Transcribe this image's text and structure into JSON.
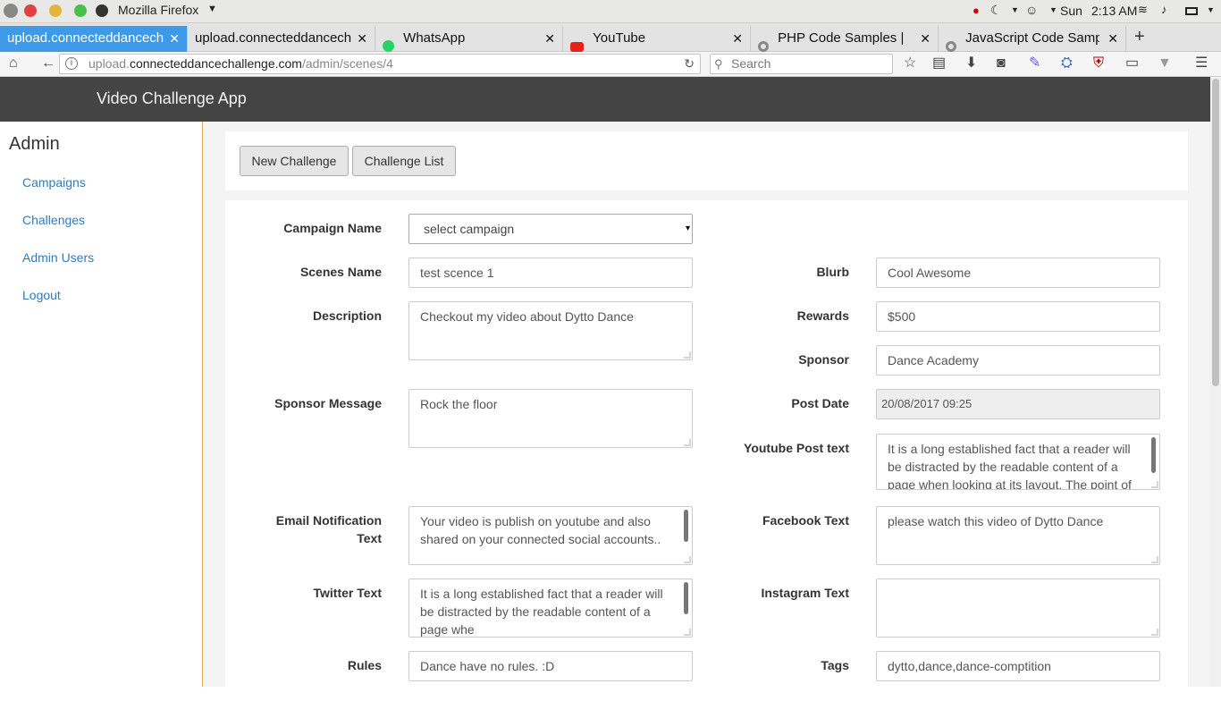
{
  "system": {
    "app_name": "Mozilla Firefox",
    "day": "Sun",
    "time": "2:13 AM"
  },
  "tabs": [
    {
      "label": "upload.connecteddancecha",
      "active": true
    },
    {
      "label": "upload.connecteddancecha"
    },
    {
      "label": "WhatsApp"
    },
    {
      "label": "YouTube"
    },
    {
      "label": "PHP Code Samples  |"
    },
    {
      "label": "JavaScript Code Sampl"
    }
  ],
  "nav": {
    "url_domain": "connecteddancechallenge.com",
    "url_prefix": "upload.",
    "url_path": "/admin/scenes/4",
    "search_placeholder": "Search"
  },
  "app": {
    "title": "Video Challenge App"
  },
  "sidebar": {
    "title": "Admin",
    "items": [
      "Campaigns",
      "Challenges",
      "Admin Users",
      "Logout"
    ]
  },
  "toolbar": {
    "new_challenge": "New Challenge",
    "challenge_list": "Challenge List"
  },
  "form": {
    "campaign_name": {
      "label": "Campaign Name",
      "value": "select campaign"
    },
    "scenes_name": {
      "label": "Scenes Name",
      "value": "test scence 1"
    },
    "description": {
      "label": "Description",
      "value": "Checkout my video about Dytto Dance"
    },
    "sponsor_message": {
      "label": "Sponsor Message",
      "value": "Rock the floor"
    },
    "email_notification": {
      "label_line1": "Email Notification",
      "label_line2": "Text",
      "value": "Your video is publish on youtube and also shared on your connected social accounts.."
    },
    "twitter_text": {
      "label": "Twitter Text",
      "value": "It is a long established fact that a reader will be distracted by the readable content of a page whe"
    },
    "rules": {
      "label": "Rules",
      "value": "Dance have no rules. :D"
    },
    "blurb": {
      "label": "Blurb",
      "value": "Cool Awesome"
    },
    "rewards": {
      "label": "Rewards",
      "value": "$500"
    },
    "sponsor": {
      "label": "Sponsor",
      "value": "Dance Academy"
    },
    "post_date": {
      "label": "Post Date",
      "value": "20/08/2017 09:25"
    },
    "youtube_post_text": {
      "label": "Youtube Post text",
      "value": "It is a long established fact that a reader will be distracted by the readable content of a page when looking at its layout. The point of"
    },
    "facebook_text": {
      "label": "Facebook Text",
      "value": "please watch this video of Dytto Dance"
    },
    "instagram_text": {
      "label": "Instagram Text",
      "value": ""
    },
    "tags": {
      "label": "Tags",
      "value": "dytto,dance,dance-comptition"
    }
  },
  "colors": {
    "header_bg": "#444444",
    "link": "#337ab7",
    "active_tab": "#3d9ae8",
    "sidebar_border": "#e8a060"
  }
}
